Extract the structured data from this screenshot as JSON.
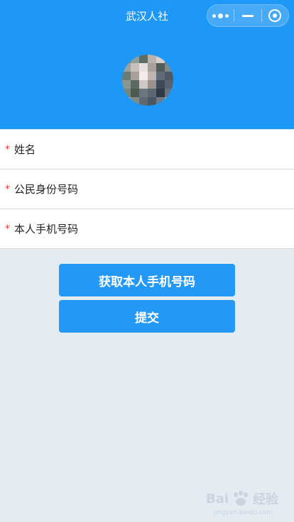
{
  "navbar": {
    "title": "武汉人社",
    "menu_icon": "more-dots-icon",
    "minimize_icon": "minimize-icon",
    "close_icon": "target-circle-icon"
  },
  "header": {
    "avatar": "avatar-pixelated"
  },
  "form": {
    "required_mark": "*",
    "fields": [
      {
        "label": "姓名"
      },
      {
        "label": "公民身份号码"
      },
      {
        "label": "本人手机号码"
      }
    ]
  },
  "actions": {
    "get_phone_label": "获取本人手机号码",
    "submit_label": "提交"
  },
  "watermark": {
    "brand": "Bai",
    "brand_cn": "经验",
    "sub": "jingyan.baidu.com"
  },
  "colors": {
    "primary": "#1e98f6",
    "button": "#2399f5",
    "background": "#e3ecf3",
    "required": "#e03b3b"
  }
}
